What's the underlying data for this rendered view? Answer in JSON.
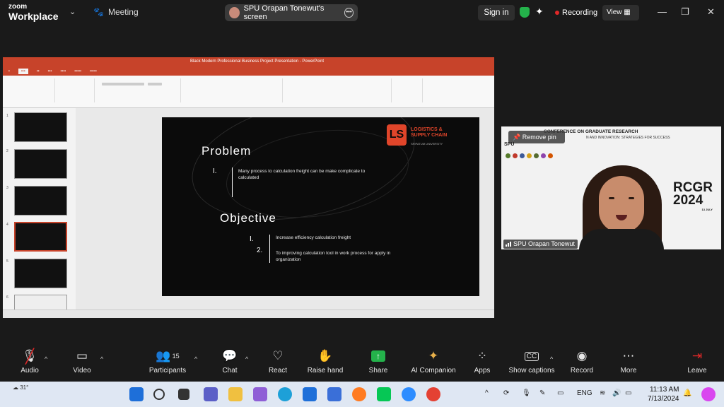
{
  "app": {
    "brand_top": "zoom",
    "brand_bottom": "Workplace"
  },
  "topbar": {
    "meeting_label": "Meeting",
    "share_label": "SPU Orapan Tonewut's screen",
    "sign_in": "Sign in",
    "recording": "Recording",
    "view": "View"
  },
  "ppt": {
    "title": "Black Modern Professional Business Project Presentation  -  PowerPoint",
    "slide_count_thumbs": [
      "1",
      "2",
      "3",
      "4",
      "5",
      "6"
    ],
    "slide": {
      "logo_line1": "LOGISTICS &",
      "logo_line2": "SUPPLY CHAIN",
      "logo_sub": "SRIPATUM UNIVERSITY",
      "problem_heading": "Problem",
      "problem_num": "I.",
      "problem_text": "Many process to calculation freight can be make complicate to calculated",
      "objective_heading": "Objective",
      "objective_num1": "I.",
      "objective_num2": "2.",
      "objective_text1": "Increase efficiency calculation freight",
      "objective_text2": "To improving calculation tool in work process for apply in organization"
    }
  },
  "video": {
    "remove_pin": "Remove pin",
    "conference": "CONFERENCE ON GRADUATE RESEARCH",
    "conference_sub": "N AND INNOVATION: STRATEGIES FOR SUCCESS",
    "rcgr": "RCGR",
    "year": "2024",
    "date": "13 JULY",
    "participant_name": "SPU Orapan Tonewut",
    "spu": "SPU"
  },
  "toolbar": {
    "audio": "Audio",
    "video": "Video",
    "participants": "Participants",
    "participants_count": "15",
    "chat": "Chat",
    "react": "React",
    "raise_hand": "Raise hand",
    "share": "Share",
    "ai_companion": "AI Companion",
    "apps": "Apps",
    "show_captions": "Show captions",
    "record": "Record",
    "more": "More",
    "leave": "Leave"
  },
  "taskbar": {
    "weather": "31°",
    "lang": "ENG",
    "time": "11:13 AM",
    "date": "7/13/2024"
  },
  "colors": {
    "accent_green": "#24b24b",
    "recording_red": "#e02828",
    "ppt_red": "#c7432a",
    "leave_red": "#e02828"
  }
}
